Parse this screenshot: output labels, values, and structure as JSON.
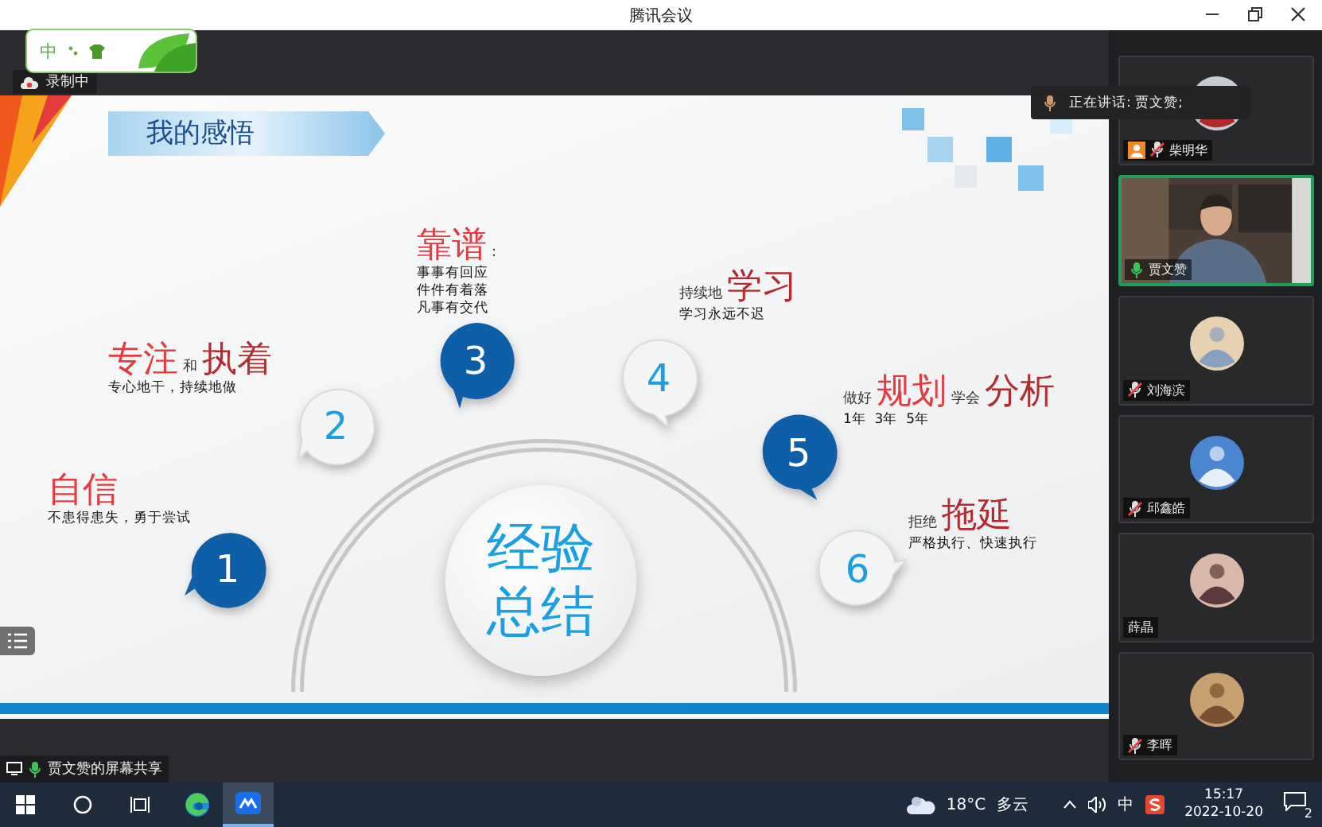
{
  "window": {
    "title": "腾讯会议"
  },
  "ime_toolbar": {
    "mode": "中"
  },
  "recording": {
    "label": "录制中"
  },
  "speaking_tooltip": {
    "text": "正在讲话: 贾文赞;"
  },
  "slide": {
    "heading": "我的感悟",
    "points": [
      {
        "title": [
          {
            "text": "自信",
            "kind": "keyword"
          }
        ],
        "lines": [
          "不患得患失，勇于尝试"
        ]
      },
      {
        "title": [
          {
            "text": "专注",
            "kind": "keyword"
          },
          {
            "text": "和",
            "kind": "connector"
          },
          {
            "text": "执着",
            "kind": "strong"
          }
        ],
        "lines": [
          "专心地干，持续地做"
        ]
      },
      {
        "title": [
          {
            "text": "靠谱",
            "kind": "keyword"
          },
          {
            "text": ":",
            "kind": "connector"
          }
        ],
        "lines": [
          "事事有回应",
          "件件有着落",
          "凡事有交代"
        ]
      },
      {
        "title": [
          {
            "text": "持续地",
            "kind": "connector"
          },
          {
            "text": "学习",
            "kind": "strong"
          }
        ],
        "lines": [
          "学习永远不迟"
        ]
      },
      {
        "title": [
          {
            "text": "做好",
            "kind": "connector"
          },
          {
            "text": "规划",
            "kind": "keyword"
          },
          {
            "text": "学会",
            "kind": "connector"
          },
          {
            "text": "分析",
            "kind": "strong"
          }
        ],
        "lines": [
          "1年  3年  5年"
        ]
      },
      {
        "title": [
          {
            "text": "拒绝",
            "kind": "connector"
          },
          {
            "text": "拖延",
            "kind": "strong"
          }
        ],
        "lines": [
          "严格执行、快速执行"
        ]
      }
    ],
    "bubbles": [
      {
        "number": "1",
        "kind": "blue"
      },
      {
        "number": "2",
        "kind": "white"
      },
      {
        "number": "3",
        "kind": "blue"
      },
      {
        "number": "4",
        "kind": "white"
      },
      {
        "number": "5",
        "kind": "blue"
      },
      {
        "number": "6",
        "kind": "white"
      }
    ],
    "center": [
      "经验",
      "总结"
    ]
  },
  "screen_share": {
    "label": "贾文赞的屏幕共享"
  },
  "participants": [
    {
      "name": "柴明华",
      "kind": "avatar",
      "mic_icon": true,
      "muted": true,
      "host": true,
      "speaking": false
    },
    {
      "name": "贾文赞",
      "kind": "video",
      "mic_icon": true,
      "muted": false,
      "host": false,
      "speaking": true
    },
    {
      "name": "刘海滨",
      "kind": "avatar",
      "mic_icon": true,
      "muted": true,
      "host": false,
      "speaking": false
    },
    {
      "name": "邱鑫皓",
      "kind": "avatar",
      "mic_icon": true,
      "muted": true,
      "host": false,
      "speaking": false
    },
    {
      "name": "薛晶",
      "kind": "avatar",
      "mic_icon": false,
      "muted": false,
      "host": false,
      "speaking": false
    },
    {
      "name": "李晖",
      "kind": "avatar",
      "mic_icon": true,
      "muted": true,
      "host": false,
      "speaking": false
    }
  ],
  "taskbar": {
    "apps": [
      {
        "kind": "edge",
        "selected": false
      },
      {
        "kind": "meeting",
        "selected": true
      }
    ],
    "temperature": "18°C",
    "weather": "多云",
    "ime": "中",
    "time": "15:17",
    "date": "2022-10-20",
    "notifications": "2"
  }
}
